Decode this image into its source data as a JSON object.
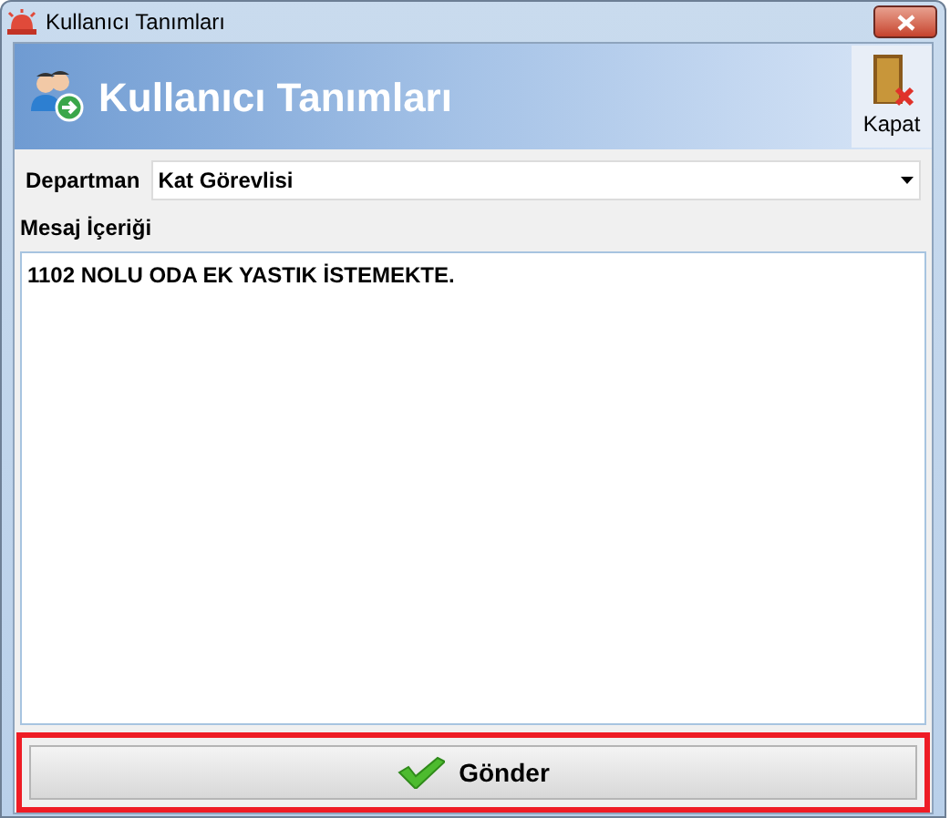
{
  "window": {
    "title": "Kullanıcı Tanımları"
  },
  "header": {
    "title": "Kullanıcı Tanımları",
    "close_label": "Kapat"
  },
  "department": {
    "label": "Departman",
    "value": "Kat Görevlisi"
  },
  "message": {
    "label": "Mesaj İçeriği",
    "value": "1102 NOLU ODA EK YASTIK İSTEMEKTE."
  },
  "send_button": {
    "label": "Gönder",
    "highlighted": true
  }
}
